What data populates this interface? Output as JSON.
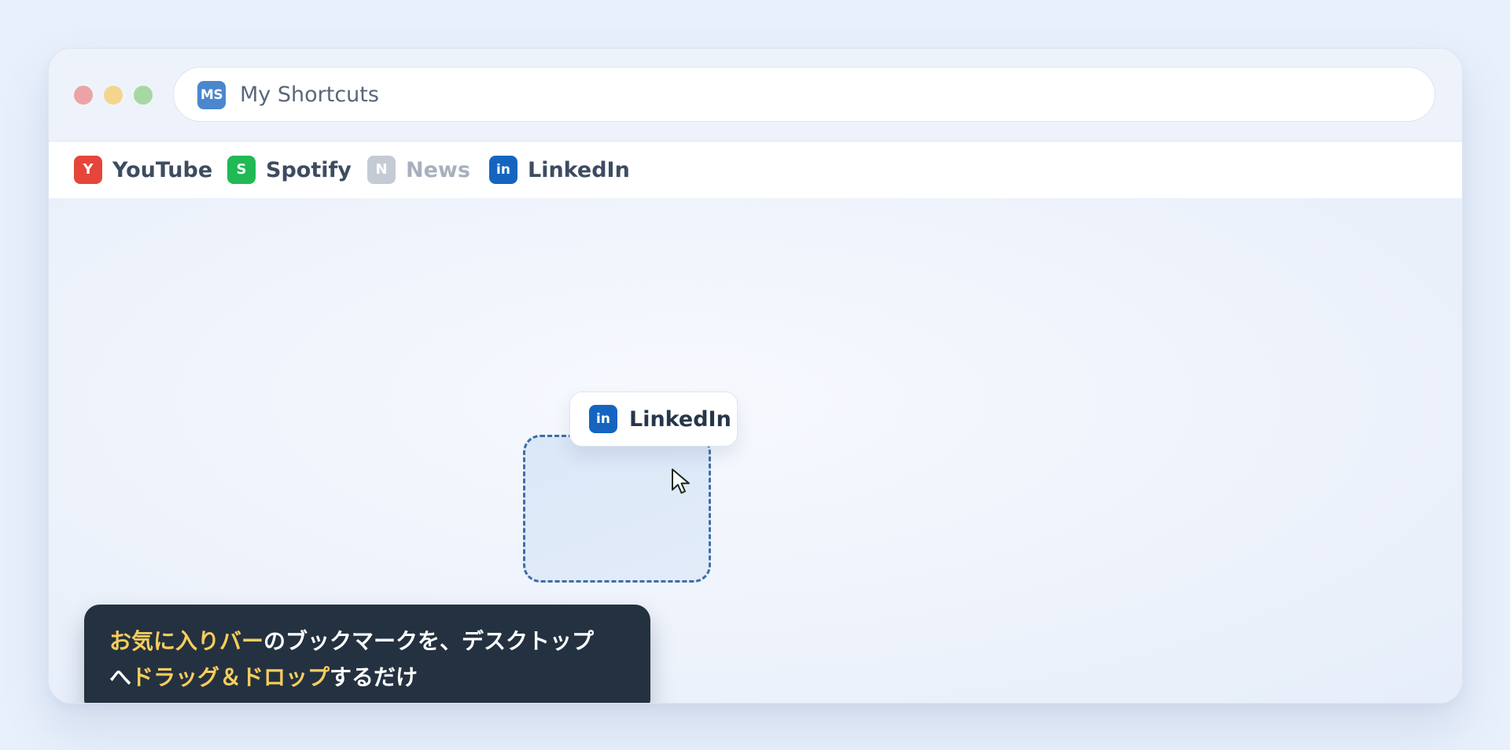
{
  "window": {
    "controls": [
      "close",
      "minimize",
      "maximize"
    ]
  },
  "address_bar": {
    "icon_text": "MS",
    "icon_color": "#4a87cd",
    "title": "My Shortcuts"
  },
  "bookmarks_bar": {
    "items": [
      {
        "icon_letter": "Y",
        "label": "YouTube",
        "color": "#e5453a",
        "state": "normal"
      },
      {
        "icon_letter": "S",
        "label": "Spotify",
        "color": "#20b954",
        "state": "normal"
      },
      {
        "icon_letter": "N",
        "label": "News",
        "color": "#c5cbd4",
        "state": "faded"
      },
      {
        "icon_letter": "in",
        "label": "LinkedIn",
        "color": "#1565c0",
        "state": "normal"
      }
    ]
  },
  "drag": {
    "chip_icon_letter": "in",
    "chip_label": "LinkedIn",
    "chip_color": "#1565c0",
    "cursor_icon": "arrow-pointer-icon"
  },
  "tooltip": {
    "part1_highlight": "お気に入りバー",
    "part2": "のブックマークを、デスクトップ",
    "part3": "へ",
    "part4_highlight": "ドラッグ＆ドロップ",
    "part5": "するだけ",
    "highlight_color": "#f7cd5c"
  }
}
